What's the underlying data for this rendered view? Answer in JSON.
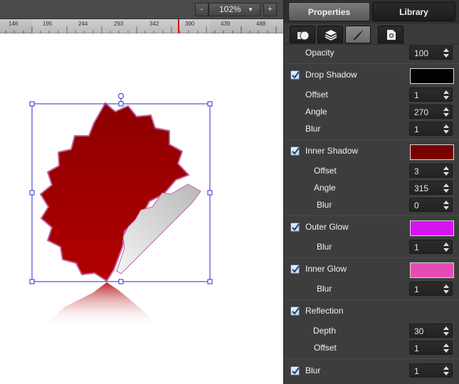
{
  "toolbar": {
    "zoom_minus": "-",
    "zoom_value": "102%",
    "zoom_plus": "+"
  },
  "ruler": {
    "ticks": [
      "146",
      "195",
      "244",
      "293",
      "342",
      "390",
      "439",
      "488"
    ]
  },
  "panel": {
    "tabs": {
      "properties": "Properties",
      "library": "Library"
    },
    "opacity": {
      "label": "Opacity",
      "value": "100"
    },
    "drop_shadow": {
      "label": "Drop Shadow",
      "checked": true,
      "color": "#000000",
      "offset": {
        "label": "Offset",
        "value": "1"
      },
      "angle": {
        "label": "Angle",
        "value": "270"
      },
      "blur": {
        "label": "Blur",
        "value": "1"
      }
    },
    "inner_shadow": {
      "label": "Inner Shadow",
      "checked": true,
      "color": "#7a0000",
      "offset": {
        "label": "Offset",
        "value": "3"
      },
      "angle": {
        "label": "Angle",
        "value": "315"
      },
      "blur": {
        "label": "Blur",
        "value": "0"
      }
    },
    "outer_glow": {
      "label": "Outer Glow",
      "checked": true,
      "color": "#d514f0",
      "blur": {
        "label": "Blur",
        "value": "1"
      }
    },
    "inner_glow": {
      "label": "Inner Glow",
      "checked": true,
      "color": "#e64bb4",
      "blur": {
        "label": "Blur",
        "value": "1"
      }
    },
    "reflection": {
      "label": "Reflection",
      "checked": true,
      "depth": {
        "label": "Depth",
        "value": "30"
      },
      "offset": {
        "label": "Offset",
        "value": "1"
      }
    },
    "blur_effect": {
      "label": "Blur",
      "checked": true,
      "value": "1"
    }
  },
  "icons": {
    "subtab1": "shape-style-icon",
    "subtab2": "layers-icon",
    "subtab3": "effects-brush-icon",
    "subtab4": "document-settings-icon"
  },
  "colors": {
    "badge_red": "#9a0000",
    "selection_blue": "#2b2bcc",
    "ruler_marker": "#d01010"
  }
}
